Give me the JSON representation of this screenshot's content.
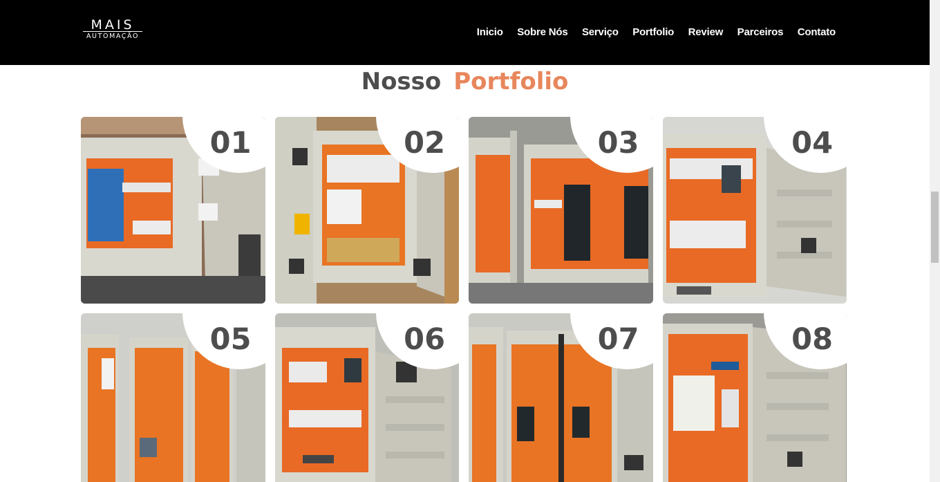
{
  "header": {
    "logo_top": "MAIS",
    "logo_bottom": "AUTOMAÇÃO",
    "nav": [
      "Inicio",
      "Sobre Nós",
      "Serviço",
      "Portfolio",
      "Review",
      "Parceiros",
      "Contato"
    ]
  },
  "section": {
    "title_part1": "Nosso",
    "title_part2": "Portfolio"
  },
  "portfolio": [
    {
      "number": "01"
    },
    {
      "number": "02"
    },
    {
      "number": "03"
    },
    {
      "number": "04"
    },
    {
      "number": "05"
    },
    {
      "number": "06"
    },
    {
      "number": "07"
    },
    {
      "number": "08"
    }
  ],
  "colors": {
    "header_bg": "#000000",
    "accent": "#e8865c",
    "title_dark": "#4d4d4d",
    "panel_orange": "#e7651f",
    "panel_grey": "#cfcfc6"
  }
}
